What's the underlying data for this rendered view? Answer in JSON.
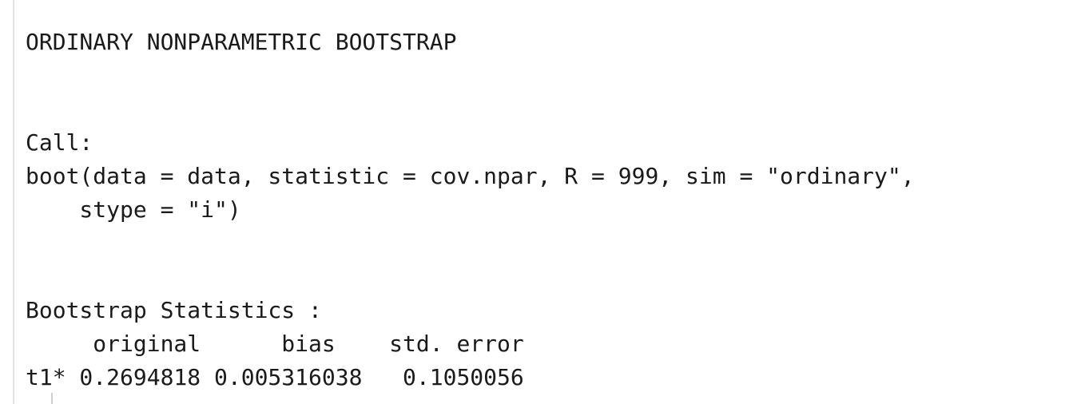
{
  "console": {
    "heading": "ORDINARY NONPARAMETRIC BOOTSTRAP",
    "call_label": "Call:",
    "call_line1": "boot(data = data, statistic = cov.npar, R = 999, sim = \"ordinary\",",
    "call_line2": "    stype = \"i\")",
    "stats_label": "Bootstrap Statistics :",
    "stats_header": "     original      bias    std. error",
    "stats_row": "t1* 0.2694818 0.005316038   0.1050056"
  }
}
